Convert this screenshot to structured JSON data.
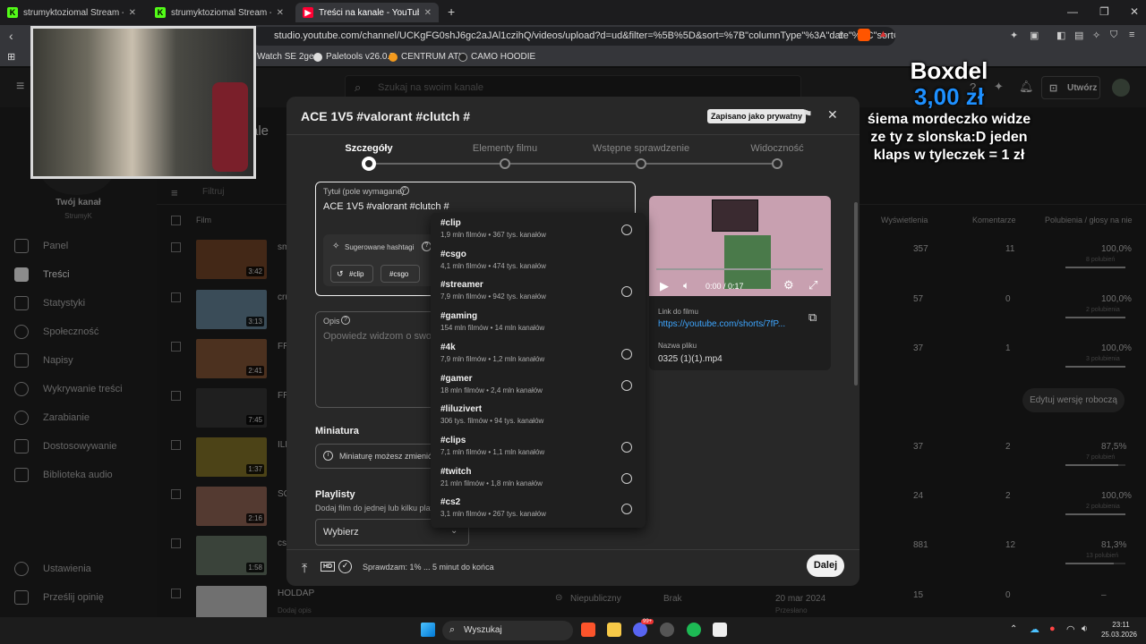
{
  "browser": {
    "tabs": [
      {
        "title": "strumyktoziomal Stream - Watch Live",
        "active": false
      },
      {
        "title": "strumyktoziomal Stream - Watch Live",
        "active": false
      },
      {
        "title": "Treści na kanale - YouTube Studio",
        "active": true
      }
    ],
    "url": "studio.youtube.com/channel/UCKgFG0shJ6gc2aJAl1czihQ/videos/upload?d=ud&filter=%5B%5D&sort=%7B\"columnType\"%3A\"date\"%2C\"sortOrder\"...",
    "bookmarks": [
      "Watch SE 2ge...",
      "Paletools v26.0.7",
      "CENTRUM ATK",
      "CAMO HOODIE"
    ]
  },
  "studio": {
    "search_placeholder": "Szukaj na swoim kanale",
    "create_label": "Utwórz",
    "channel_heading": "Twój kanał",
    "channel_name": "StrumyK",
    "page_title_fragment": "ale",
    "filter_placeholder": "Filtruj",
    "nav": [
      "Panel",
      "Treści",
      "Statystyki",
      "Społeczność",
      "Napisy",
      "Wykrywanie treści",
      "Zarabianie",
      "Dostosowywanie",
      "Biblioteka audio"
    ],
    "nav_bottom": [
      "Ustawienia",
      "Prześlij opinię"
    ],
    "columns": {
      "film": "Film",
      "views": "Wyświetlenia",
      "comments": "Komentarze",
      "likes": "Polubienia / głosy na nie"
    },
    "rows": [
      {
        "duration": "3:42",
        "title": "sm",
        "views": "357",
        "comments": "11",
        "likes": "100,0%",
        "likes_sub": "8 polubień",
        "likes_pct": 100
      },
      {
        "duration": "3:13",
        "title": "cru",
        "views": "57",
        "comments": "0",
        "likes": "100,0%",
        "likes_sub": "2 polubienia",
        "likes_pct": 100
      },
      {
        "duration": "2:41",
        "title": "FR",
        "views": "37",
        "comments": "1",
        "likes": "100,0%",
        "likes_sub": "3 polubienia",
        "likes_pct": 100
      },
      {
        "duration": "7:45",
        "title": "FR",
        "views": "",
        "comments": "",
        "likes": "",
        "likes_sub": "",
        "likes_pct": 0
      },
      {
        "duration": "1:37",
        "title": "ILF",
        "views": "37",
        "comments": "2",
        "likes": "87,5%",
        "likes_sub": "7 polubień",
        "likes_pct": 87.5
      },
      {
        "duration": "2:16",
        "title": "SO",
        "views": "24",
        "comments": "2",
        "likes": "100,0%",
        "likes_sub": "2 polubienia",
        "likes_pct": 100
      },
      {
        "duration": "1:58",
        "title": "cs2",
        "views": "881",
        "comments": "12",
        "likes": "81,3%",
        "likes_sub": "13 polubień",
        "likes_pct": 81.3
      },
      {
        "duration": "",
        "title": "HOLDAP",
        "views": "15",
        "comments": "0",
        "likes": "–",
        "likes_sub": "",
        "likes_pct": 0
      }
    ],
    "last_row": {
      "sub": "Dodaj opis",
      "visibility": "Niepubliczny",
      "restrictions": "Brak",
      "date": "20 mar 2024",
      "date_sub": "Przesłano"
    },
    "draft_button": "Edytuj wersję roboczą"
  },
  "modal": {
    "title": "ACE 1V5 #valorant #clutch #",
    "saved_badge": "Zapisano jako prywatny",
    "steps": [
      "Szczegóły",
      "Elementy filmu",
      "Wstępne sprawdzenie",
      "Widoczność"
    ],
    "title_label": "Tytuł (pole wymagane)",
    "title_value": "ACE 1V5 #valorant #clutch #",
    "suggested_label": "Sugerowane hashtagi",
    "suggested_chips": [
      "#clip",
      "#csgo"
    ],
    "desc_label": "Opis",
    "desc_placeholder": "Opowiedz widzom o swoim",
    "thumb_title": "Miniatura",
    "thumb_info": "Miniaturę możesz zmienić w",
    "playlists_title": "Playlisty",
    "playlists_desc": "Dodaj film do jednej lub kilku playl",
    "playlists_select": "Wybierz",
    "player_time": "0:00 / 0:17",
    "link_label": "Link do filmu",
    "link_value": "https://youtube.com/shorts/7fP...",
    "file_label": "Nazwa pliku",
    "file_value": "0325 (1)(1).mp4",
    "status": "Sprawdzam: 1% ... 5 minut do końca",
    "next_button": "Dalej",
    "hd_badge": "HD"
  },
  "suggestions": [
    {
      "tag": "#clip",
      "meta": "1,9 mln filmów • 367 tys. kanałów",
      "history": true
    },
    {
      "tag": "#csgo",
      "meta": "4,1 mln filmów • 474 tys. kanałów",
      "history": false
    },
    {
      "tag": "#streamer",
      "meta": "7,9 mln filmów • 942 tys. kanałów",
      "history": true
    },
    {
      "tag": "#gaming",
      "meta": "154 mln filmów • 14 mln kanałów",
      "history": false
    },
    {
      "tag": "#4k",
      "meta": "7,9 mln filmów • 1,2 mln kanałów",
      "history": true
    },
    {
      "tag": "#gamer",
      "meta": "18 mln filmów • 2,4 mln kanałów",
      "history": true
    },
    {
      "tag": "#liluzivert",
      "meta": "306 tys. filmów • 94 tys. kanałów",
      "history": false
    },
    {
      "tag": "#clips",
      "meta": "7,1 mln filmów • 1,1 mln kanałów",
      "history": true
    },
    {
      "tag": "#twitch",
      "meta": "21 mln filmów • 1,8 mln kanałów",
      "history": true
    },
    {
      "tag": "#cs2",
      "meta": "3,1 mln filmów • 267 tys. kanałów",
      "history": true
    }
  ],
  "donation": {
    "name": "Boxdel",
    "amount": "3,00 zł",
    "message": "śiema mordeczko widze ze ty z slonska:D jeden klaps w tyleczek = 1 zł"
  },
  "taskbar": {
    "search": "Wyszukaj",
    "time": "23:11",
    "date": "25.03.2026",
    "badge": "99+"
  },
  "colors": {
    "accent": "#3ea6ff",
    "donation_amount": "#1e90ff",
    "twitch_green": "#53fc18",
    "yt_red": "#ff0033"
  }
}
